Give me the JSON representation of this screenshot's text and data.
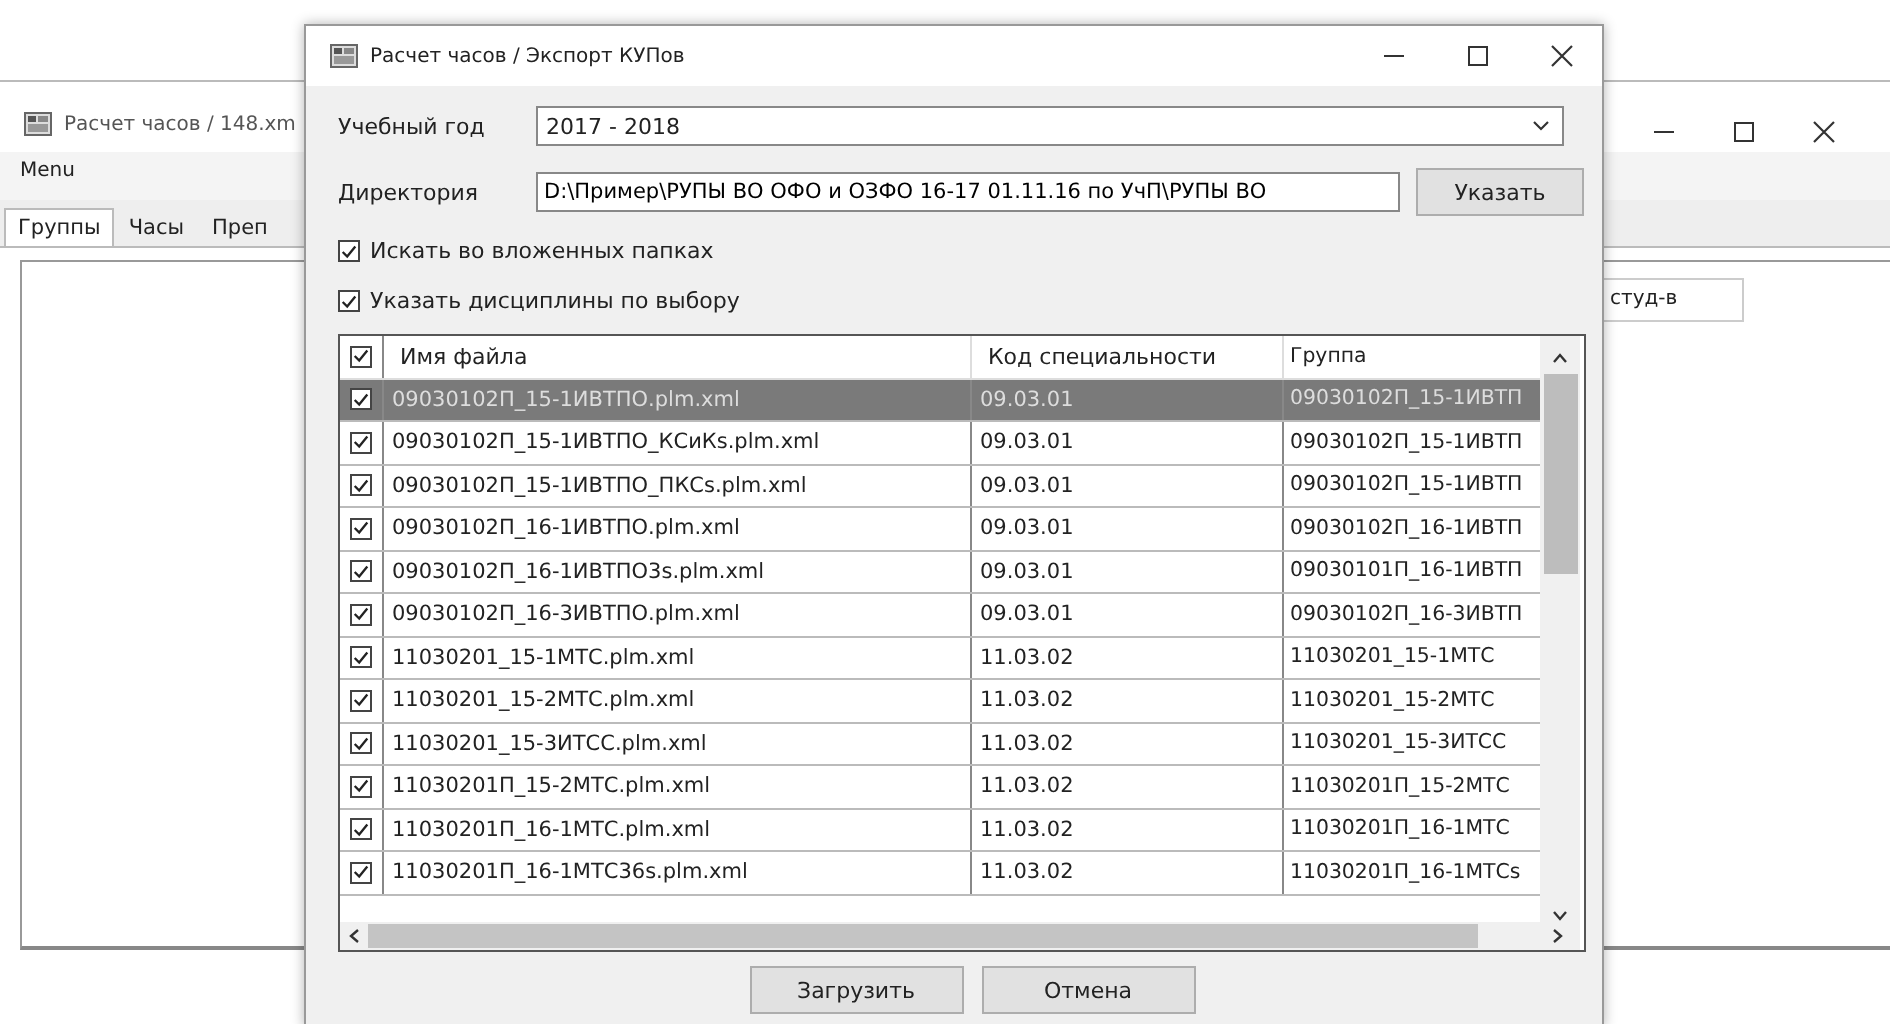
{
  "background_window": {
    "title": "Расчет часов / 148.xm",
    "menu": [
      "Menu"
    ],
    "tabs": [
      {
        "label": "Группы",
        "selected": true
      },
      {
        "label": "Часы",
        "selected": false
      },
      {
        "label": "Преп",
        "selected": false
      }
    ],
    "column_header": "студ-в"
  },
  "dialog": {
    "title": "Расчет часов / Экспорт КУПов",
    "year": {
      "label": "Учебный год",
      "value": "2017 - 2018"
    },
    "directory": {
      "label": "Директория",
      "value": "D:\\Пример\\РУПЫ ВО ОФО и ОЗФО 16-17 01.11.16 по УчП\\РУПЫ ВО",
      "button": "Указать"
    },
    "options": [
      {
        "label": "Искать во вложенных папках",
        "checked": true
      },
      {
        "label": "Указать дисциплины по выбору",
        "checked": true
      }
    ],
    "table": {
      "header_checked": true,
      "columns": [
        "Имя файла",
        "Код специальности",
        "Группа"
      ],
      "rows": [
        {
          "checked": true,
          "selected": true,
          "cells": [
            "09030102П_15-1ИВТПО.plm.xml",
            "09.03.01",
            "09030102П_15-1ИВТП"
          ]
        },
        {
          "checked": true,
          "selected": false,
          "cells": [
            "09030102П_15-1ИВТПО_КСиКs.plm.xml",
            "09.03.01",
            "09030102П_15-1ИВТП"
          ]
        },
        {
          "checked": true,
          "selected": false,
          "cells": [
            "09030102П_15-1ИВТПО_ПКСs.plm.xml",
            "09.03.01",
            "09030102П_15-1ИВТП"
          ]
        },
        {
          "checked": true,
          "selected": false,
          "cells": [
            "09030102П_16-1ИВТПО.plm.xml",
            "09.03.01",
            "09030102П_16-1ИВТП"
          ]
        },
        {
          "checked": true,
          "selected": false,
          "cells": [
            "09030102П_16-1ИВТПО3s.plm.xml",
            "09.03.01",
            "09030101П_16-1ИВТП"
          ]
        },
        {
          "checked": true,
          "selected": false,
          "cells": [
            "09030102П_16-3ИВТПО.plm.xml",
            "09.03.01",
            "09030102П_16-3ИВТП"
          ]
        },
        {
          "checked": true,
          "selected": false,
          "cells": [
            "11030201_15-1МТС.plm.xml",
            "11.03.02",
            "11030201_15-1МТС"
          ]
        },
        {
          "checked": true,
          "selected": false,
          "cells": [
            "11030201_15-2МТС.plm.xml",
            "11.03.02",
            "11030201_15-2МТС"
          ]
        },
        {
          "checked": true,
          "selected": false,
          "cells": [
            "11030201_15-3ИТСС.plm.xml",
            "11.03.02",
            "11030201_15-3ИТСС"
          ]
        },
        {
          "checked": true,
          "selected": false,
          "cells": [
            "11030201П_15-2МТС.plm.xml",
            "11.03.02",
            "11030201П_15-2МТС"
          ]
        },
        {
          "checked": true,
          "selected": false,
          "cells": [
            "11030201П_16-1МТС.plm.xml",
            "11.03.02",
            "11030201П_16-1МТС"
          ]
        },
        {
          "checked": true,
          "selected": false,
          "cells": [
            "11030201П_16-1МТС36s.plm.xml",
            "11.03.02",
            "11030201П_16-1МТСs"
          ]
        }
      ]
    },
    "buttons": [
      "Загрузить",
      "Отмена"
    ]
  }
}
